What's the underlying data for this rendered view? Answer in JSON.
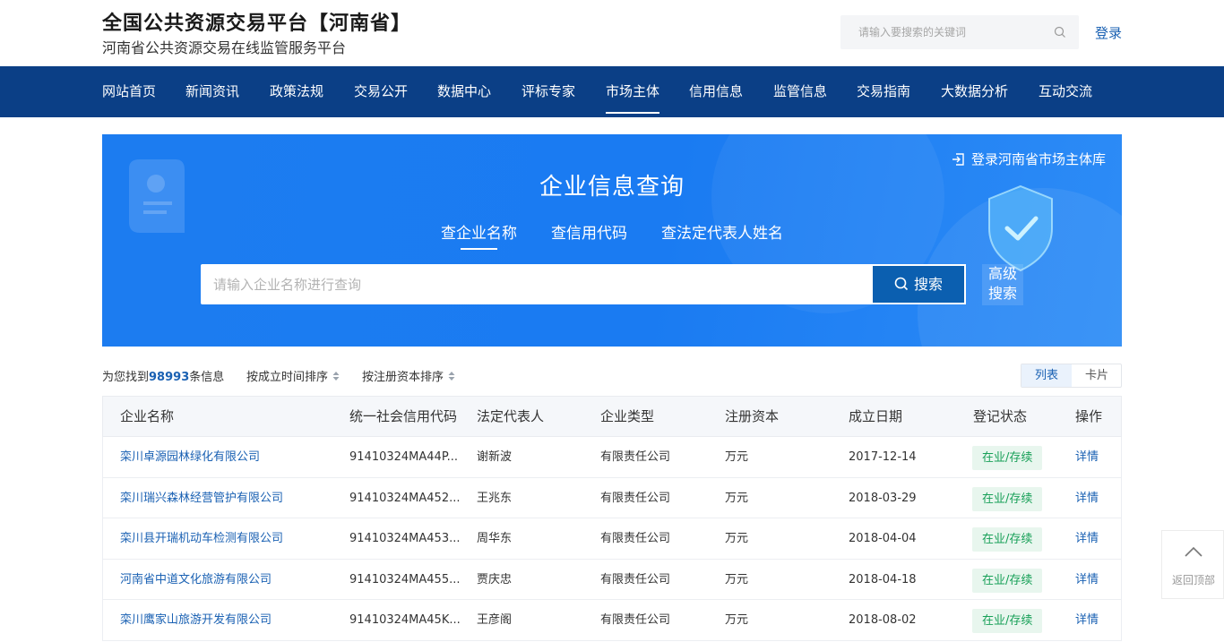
{
  "header": {
    "title": "全国公共资源交易平台【河南省】",
    "subtitle": "河南省公共资源交易在线监管服务平台",
    "search_placeholder": "请输入要搜索的关键词",
    "login_label": "登录"
  },
  "nav": {
    "items": [
      "网站首页",
      "新闻资讯",
      "政策法规",
      "交易公开",
      "数据中心",
      "评标专家",
      "市场主体",
      "信用信息",
      "监管信息",
      "交易指南",
      "大数据分析",
      "互动交流"
    ],
    "active_index": 6
  },
  "banner": {
    "login_link": "登录河南省市场主体库",
    "title": "企业信息查询",
    "tabs": [
      "查企业名称",
      "查信用代码",
      "查法定代表人姓名"
    ],
    "active_tab": 0,
    "search_placeholder": "请输入企业名称进行查询",
    "search_button": "搜索",
    "advanced_search": "高级搜索"
  },
  "toolbar": {
    "result_prefix": "为您找到",
    "result_count": "98993",
    "result_suffix": "条信息",
    "sort_by_date": "按成立时间排序",
    "sort_by_capital": "按注册资本排序",
    "view_list": "列表",
    "view_card": "卡片"
  },
  "table": {
    "columns": [
      "企业名称",
      "统一社会信用代码",
      "法定代表人",
      "企业类型",
      "注册资本",
      "成立日期",
      "登记状态",
      "操作"
    ],
    "rows": [
      {
        "name": "栾川卓源园林绿化有限公司",
        "code": "91410324MA44P...",
        "rep": "谢新波",
        "type": "有限责任公司",
        "capital": "万元",
        "date": "2017-12-14",
        "status": "在业/存续",
        "action": "详情"
      },
      {
        "name": "栾川瑞兴森林经营管护有限公司",
        "code": "91410324MA452...",
        "rep": "王兆东",
        "type": "有限责任公司",
        "capital": "万元",
        "date": "2018-03-29",
        "status": "在业/存续",
        "action": "详情"
      },
      {
        "name": "栾川县开瑞机动车检测有限公司",
        "code": "91410324MA453...",
        "rep": "周华东",
        "type": "有限责任公司",
        "capital": "万元",
        "date": "2018-04-04",
        "status": "在业/存续",
        "action": "详情"
      },
      {
        "name": "河南省中道文化旅游有限公司",
        "code": "91410324MA455...",
        "rep": "贾庆忠",
        "type": "有限责任公司",
        "capital": "万元",
        "date": "2018-04-18",
        "status": "在业/存续",
        "action": "详情"
      },
      {
        "name": "栾川鹰家山旅游开发有限公司",
        "code": "91410324MA45K...",
        "rep": "王彦阁",
        "type": "有限责任公司",
        "capital": "万元",
        "date": "2018-08-02",
        "status": "在业/存续",
        "action": "详情"
      }
    ]
  },
  "back_to_top": "返回顶部",
  "colors": {
    "nav_bg": "#0b3f86",
    "banner_blue": "#1c7cf0",
    "link_blue": "#1a61b3",
    "status_green": "#18a058",
    "status_bg": "#e8f6ee"
  }
}
